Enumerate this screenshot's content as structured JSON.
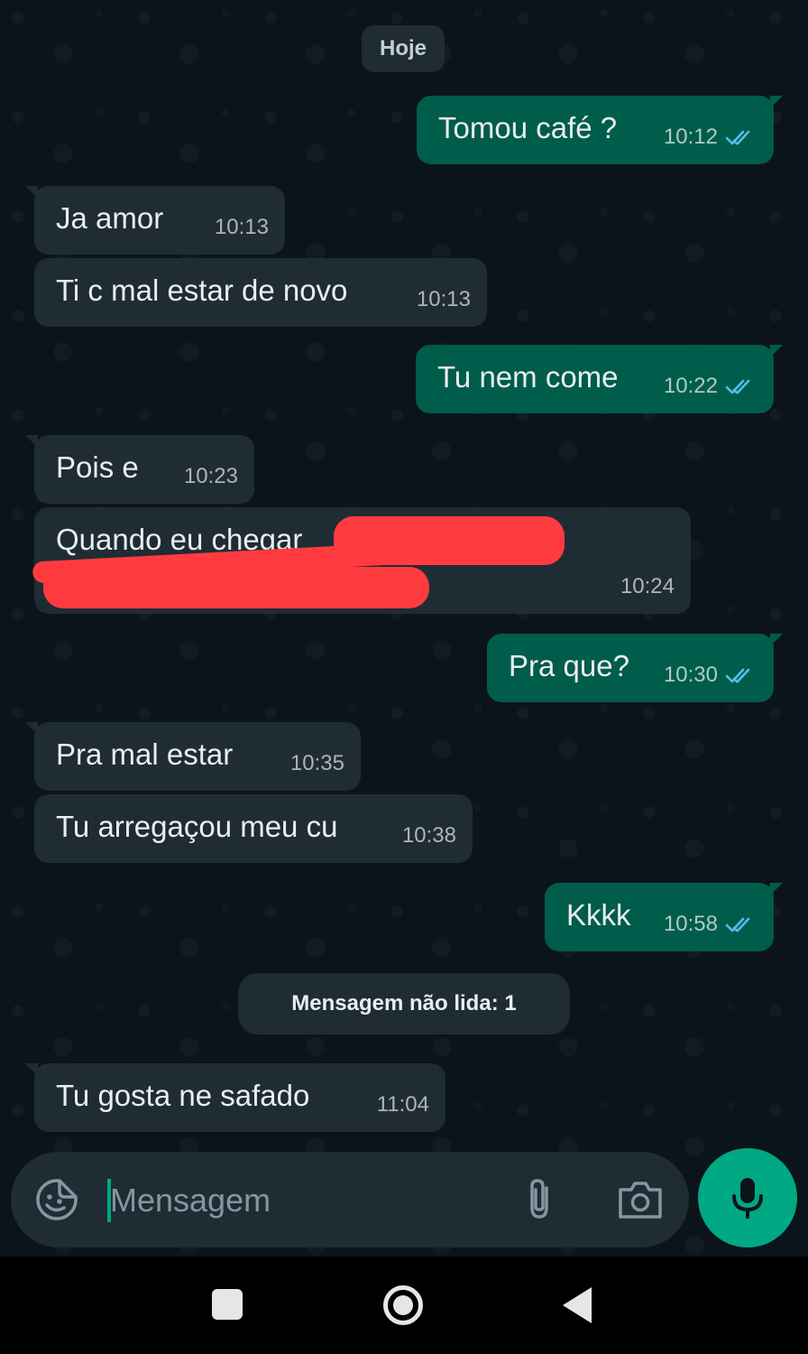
{
  "chat": {
    "date_label": "Hoje",
    "unread_label": "Mensagem não lida: 1",
    "messages": [
      {
        "dir": "out",
        "text": "Tomou café ?",
        "time": "10:12",
        "status": "read"
      },
      {
        "dir": "in",
        "text": "Ja amor",
        "time": "10:13"
      },
      {
        "dir": "in",
        "text": "Ti c mal estar de novo",
        "time": "10:13"
      },
      {
        "dir": "out",
        "text": "Tu nem come",
        "time": "10:22",
        "status": "read"
      },
      {
        "dir": "in",
        "text": "Pois e",
        "time": "10:23"
      },
      {
        "dir": "in",
        "text": "Quando eu chegar",
        "time": "10:24",
        "redacted": true
      },
      {
        "dir": "out",
        "text": "Pra que?",
        "time": "10:30",
        "status": "read"
      },
      {
        "dir": "in",
        "text": "Pra mal estar",
        "time": "10:35"
      },
      {
        "dir": "in",
        "text": "Tu arregaçou meu cu",
        "time": "10:38"
      },
      {
        "dir": "out",
        "text": "Kkkk",
        "time": "10:58",
        "status": "read"
      },
      {
        "dir": "in",
        "text": "Tu gosta ne safado",
        "time": "11:04"
      }
    ]
  },
  "composer": {
    "placeholder": "Mensagem",
    "emoji_icon": "sticker-icon",
    "attach_icon": "paperclip-icon",
    "camera_icon": "camera-icon",
    "mic_icon": "mic-icon"
  },
  "navbar": {
    "recents_icon": "square-icon",
    "home_icon": "circle-icon",
    "back_icon": "triangle-back-icon"
  },
  "colors": {
    "background": "#0b141a",
    "incoming_bubble": "#202c33",
    "outgoing_bubble": "#005c4b",
    "accent": "#00a884",
    "read_ticks": "#53bdeb",
    "redaction": "#ff3b3f"
  }
}
